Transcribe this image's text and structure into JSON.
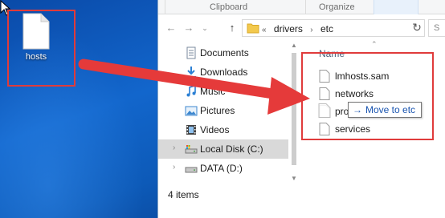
{
  "desktop": {
    "icon_label": "hosts"
  },
  "ribbon": {
    "groups": [
      "Clipboard",
      "Organize"
    ],
    "search_fragment": "S"
  },
  "address": {
    "crumbs": [
      "«",
      "drivers",
      "›",
      "etc"
    ]
  },
  "nav_pane": {
    "items": [
      {
        "label": "Documents",
        "icon": "documents-icon"
      },
      {
        "label": "Downloads",
        "icon": "downloads-icon"
      },
      {
        "label": "Music",
        "icon": "music-icon"
      },
      {
        "label": "Pictures",
        "icon": "pictures-icon"
      },
      {
        "label": "Videos",
        "icon": "videos-icon"
      },
      {
        "label": "Local Disk (C:)",
        "icon": "local-disk-icon",
        "selected": true
      },
      {
        "label": "DATA (D:)",
        "icon": "drive-icon"
      }
    ]
  },
  "files": {
    "column_header": "Name",
    "items": [
      "lmhosts.sam",
      "networks",
      "pro",
      "services"
    ]
  },
  "drag_tooltip": {
    "label": "Move to etc"
  },
  "status_bar": {
    "item_count": "4 items"
  },
  "colors": {
    "highlight_box": "#e03b3b",
    "arrow": "#e53a3a",
    "desktop": "#1266cc"
  }
}
